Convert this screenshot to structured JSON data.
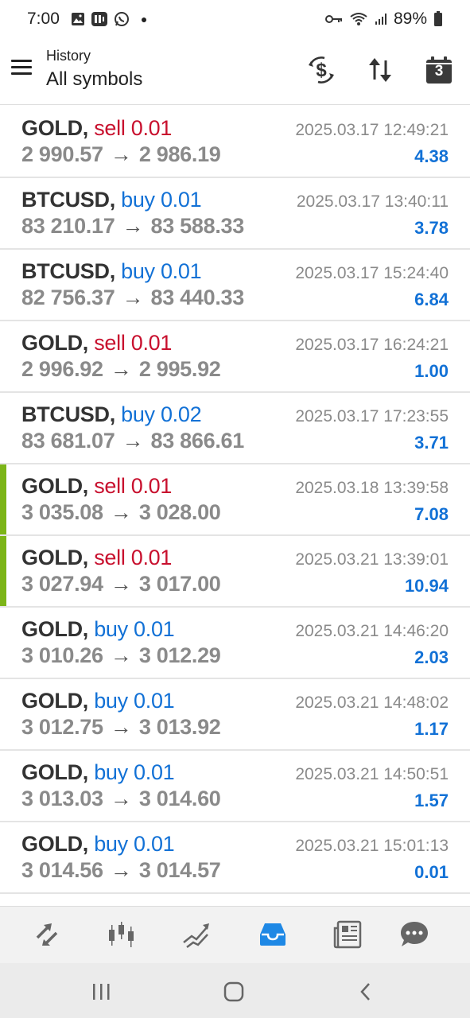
{
  "status_bar": {
    "time": "7:00",
    "battery": "89%",
    "icons": [
      "gallery-icon",
      "app-badge-icon",
      "whatsapp-icon",
      "notification-dot",
      "key-icon",
      "wifi-icon",
      "signal-icon",
      "battery-icon"
    ]
  },
  "header": {
    "subtitle": "History",
    "title": "All symbols",
    "calendar_day": "3",
    "actions": [
      "currency-exchange-icon",
      "sort-icon",
      "calendar-icon"
    ]
  },
  "trades": [
    {
      "symbol": "GOLD,",
      "side": "sell",
      "volume": "0.01",
      "open": "2 990.57",
      "close": "2 986.19",
      "time": "2025.03.17 12:49:21",
      "profit": "4.38",
      "accent": false
    },
    {
      "symbol": "BTCUSD,",
      "side": "buy",
      "volume": "0.01",
      "open": "83 210.17",
      "close": "83 588.33",
      "time": "2025.03.17 13:40:11",
      "profit": "3.78",
      "accent": false
    },
    {
      "symbol": "BTCUSD,",
      "side": "buy",
      "volume": "0.01",
      "open": "82 756.37",
      "close": "83 440.33",
      "time": "2025.03.17 15:24:40",
      "profit": "6.84",
      "accent": false
    },
    {
      "symbol": "GOLD,",
      "side": "sell",
      "volume": "0.01",
      "open": "2 996.92",
      "close": "2 995.92",
      "time": "2025.03.17 16:24:21",
      "profit": "1.00",
      "accent": false
    },
    {
      "symbol": "BTCUSD,",
      "side": "buy",
      "volume": "0.02",
      "open": "83 681.07",
      "close": "83 866.61",
      "time": "2025.03.17 17:23:55",
      "profit": "3.71",
      "accent": false
    },
    {
      "symbol": "GOLD,",
      "side": "sell",
      "volume": "0.01",
      "open": "3 035.08",
      "close": "3 028.00",
      "time": "2025.03.18 13:39:58",
      "profit": "7.08",
      "accent": true
    },
    {
      "symbol": "GOLD,",
      "side": "sell",
      "volume": "0.01",
      "open": "3 027.94",
      "close": "3 017.00",
      "time": "2025.03.21 13:39:01",
      "profit": "10.94",
      "accent": true
    },
    {
      "symbol": "GOLD,",
      "side": "buy",
      "volume": "0.01",
      "open": "3 010.26",
      "close": "3 012.29",
      "time": "2025.03.21 14:46:20",
      "profit": "2.03",
      "accent": false
    },
    {
      "symbol": "GOLD,",
      "side": "buy",
      "volume": "0.01",
      "open": "3 012.75",
      "close": "3 013.92",
      "time": "2025.03.21 14:48:02",
      "profit": "1.17",
      "accent": false
    },
    {
      "symbol": "GOLD,",
      "side": "buy",
      "volume": "0.01",
      "open": "3 013.03",
      "close": "3 014.60",
      "time": "2025.03.21 14:50:51",
      "profit": "1.57",
      "accent": false
    },
    {
      "symbol": "GOLD,",
      "side": "buy",
      "volume": "0.01",
      "open": "3 014.56",
      "close": "3 014.57",
      "time": "2025.03.21 15:01:13",
      "profit": "0.01",
      "accent": false
    }
  ],
  "colors": {
    "sell": "#c8102e",
    "buy": "#1271d6",
    "profit": "#1271d6",
    "accent": "#7cb518",
    "nav_active": "#1e88e5"
  },
  "bottom_nav": [
    {
      "name": "quotes-icon",
      "active": false
    },
    {
      "name": "chart-icon",
      "active": false
    },
    {
      "name": "trade-icon",
      "active": false
    },
    {
      "name": "history-icon",
      "active": true
    },
    {
      "name": "news-icon",
      "active": false
    },
    {
      "name": "chat-icon",
      "active": false
    }
  ],
  "system_nav": [
    "recents-button",
    "home-button",
    "back-button"
  ]
}
